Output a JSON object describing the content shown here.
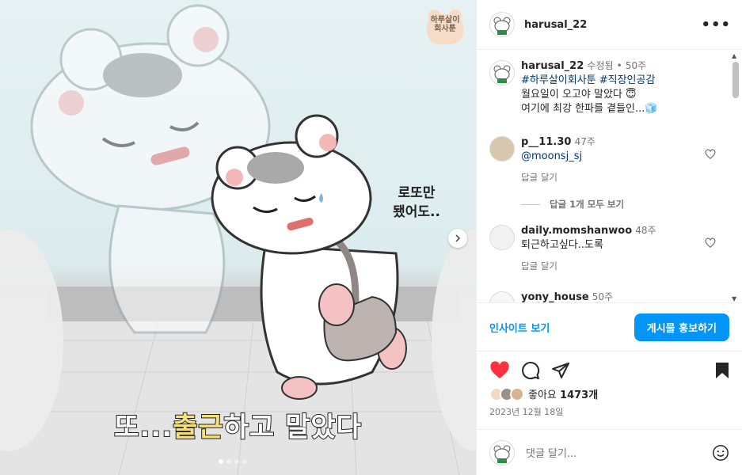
{
  "post": {
    "brand_badge": [
      "하루살이",
      "회사툰"
    ],
    "speech_bubble": [
      "로또만",
      "됐어도.."
    ],
    "caption_before": "또...",
    "caption_highlight": "출근",
    "caption_after": "하고 말았다",
    "carousel_dots": 4
  },
  "header": {
    "username": "harusal_22",
    "more_icon": "more-horizontal-icon"
  },
  "author_caption": {
    "username": "harusal_22",
    "edited": "수정됨",
    "separator": "•",
    "age": "50주",
    "hashtags": "#하루살이회사툰 #직장인공감",
    "line1": "월요일이 오고야 말았다 😇",
    "line2": "여기에 최강 한파를 곁들인...🧊"
  },
  "comments": [
    {
      "username": "p__11.30",
      "age": "47주",
      "text": "@moonsj_sj",
      "reply": "답글 달기"
    },
    {
      "username": "daily.momshanwoo",
      "age": "48주",
      "text": "퇴근하고싶다..도록",
      "reply": "답글 달기"
    },
    {
      "username": "yony_house",
      "age": "50주"
    }
  ],
  "view_replies": "답글 1개 모두 보기",
  "promo": {
    "insights": "인사이트 보기",
    "boost": "게시물 홍보하기"
  },
  "likes": {
    "label": "좋아요",
    "count": "1473개"
  },
  "date": "2023년 12월 18일",
  "add_comment": {
    "placeholder": "댓글 달기..."
  },
  "colors": {
    "accent": "#0095f6",
    "like_red": "#ff3040",
    "caption_highlight": "#f6e07a"
  }
}
